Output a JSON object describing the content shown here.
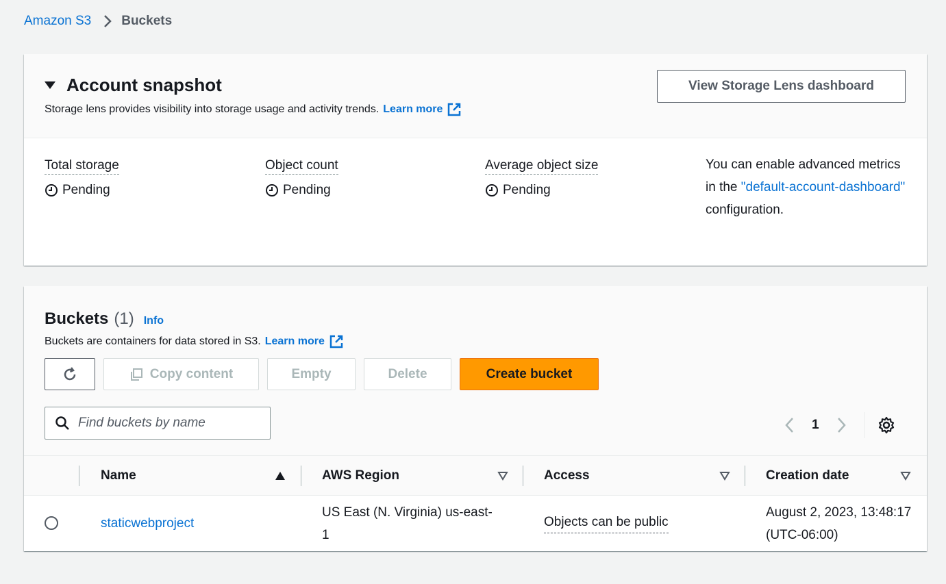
{
  "breadcrumb": {
    "root": "Amazon S3",
    "current": "Buckets"
  },
  "snapshot": {
    "title": "Account snapshot",
    "description": "Storage lens provides visibility into storage usage and activity trends.",
    "learn_more": "Learn more",
    "dashboard_button": "View Storage Lens dashboard",
    "metrics": [
      {
        "label": "Total storage",
        "value": "Pending"
      },
      {
        "label": "Object count",
        "value": "Pending"
      },
      {
        "label": "Average object size",
        "value": "Pending"
      }
    ],
    "advanced_note_pre": "You can enable advanced metrics in the",
    "advanced_note_link": "\"default-account-dashboard\"",
    "advanced_note_post": "configuration."
  },
  "buckets": {
    "title": "Buckets",
    "count": "(1)",
    "info": "Info",
    "description": "Buckets are containers for data stored in S3.",
    "learn_more": "Learn more",
    "actions": {
      "copy": "Copy content",
      "empty": "Empty",
      "delete": "Delete",
      "create": "Create bucket"
    },
    "search_placeholder": "Find buckets by name",
    "pagination": {
      "current_page": "1"
    },
    "columns": [
      "Name",
      "AWS Region",
      "Access",
      "Creation date"
    ],
    "rows": [
      {
        "name": "staticwebproject",
        "region": "US East (N. Virginia) us-east-1",
        "access": "Objects can be public",
        "created": "August 2, 2023, 13:48:17 (UTC-06:00)"
      }
    ]
  },
  "colors": {
    "link": "#0972d3",
    "primary_button": "#ff9900",
    "page_bg": "#f2f3f3"
  }
}
